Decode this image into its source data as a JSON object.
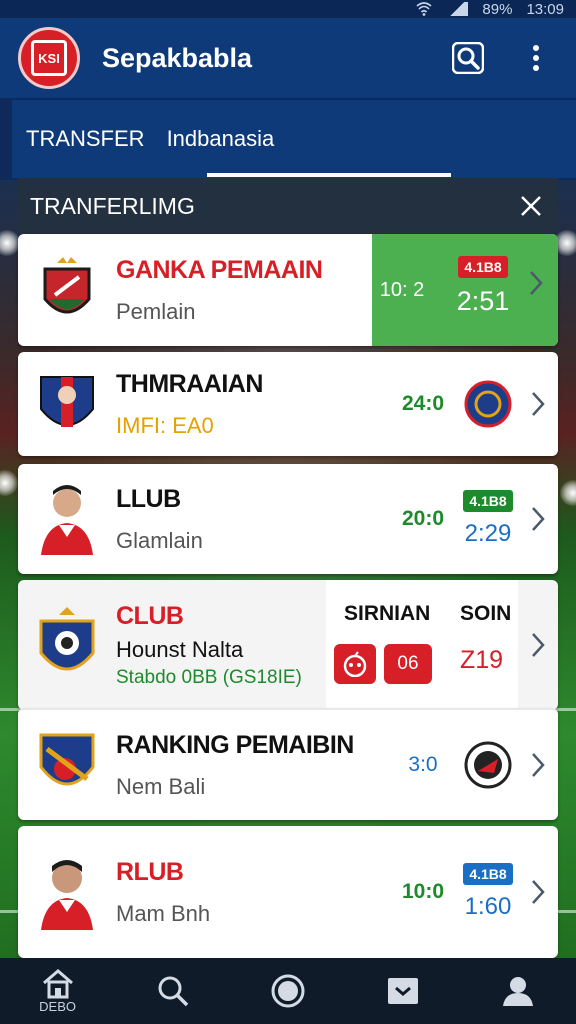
{
  "status": {
    "battery": "89%",
    "time": "13:09"
  },
  "app": {
    "title": "Sepakbabla",
    "logo_text": "KSI"
  },
  "tabs": [
    {
      "label": "TRANSFER"
    },
    {
      "label": "Indbanasia"
    }
  ],
  "panel": {
    "title": "TRANFERLIMG"
  },
  "rows": [
    {
      "title": "GANKA PEMAAIN",
      "subtitle": "Pemlain",
      "score": "10: 2",
      "pill": "4.1B8",
      "time": "2:51",
      "accent": "#d61f26"
    },
    {
      "title": "THMRAAIAN",
      "subtitle": "IMFI: EA0",
      "score": "24:0"
    },
    {
      "title": "LLUB",
      "subtitle": "Glamlain",
      "score": "20:0",
      "pill": "4.1B8",
      "time": "2:29"
    },
    {
      "title": "CLUB",
      "subtitle": "Hounst Nalta",
      "line3": "Stabdo 0BB (GS18IE)",
      "label_a": "SIRNIAN",
      "label_b": "SOIN",
      "btn_value": "06",
      "time": "Z19"
    },
    {
      "title": "RANKING PEMAIBIN",
      "subtitle": "Nem Bali",
      "score": "3:0"
    },
    {
      "title": "RLUB",
      "subtitle": "Mam Bnh",
      "score": "10:0",
      "pill": "4.1B8",
      "time": "1:60"
    }
  ],
  "nav": [
    {
      "label": "DEBO",
      "icon": "home-icon"
    },
    {
      "label": "",
      "icon": "search-icon"
    },
    {
      "label": "",
      "icon": "circle-icon"
    },
    {
      "label": "",
      "icon": "inbox-icon"
    },
    {
      "label": "",
      "icon": "profile-icon"
    }
  ],
  "colors": {
    "primary": "#0f3a7a",
    "accent": "#d61f26",
    "highlight": "#4caf50",
    "green": "#1d8a2b",
    "blue": "#1a6fc4"
  }
}
